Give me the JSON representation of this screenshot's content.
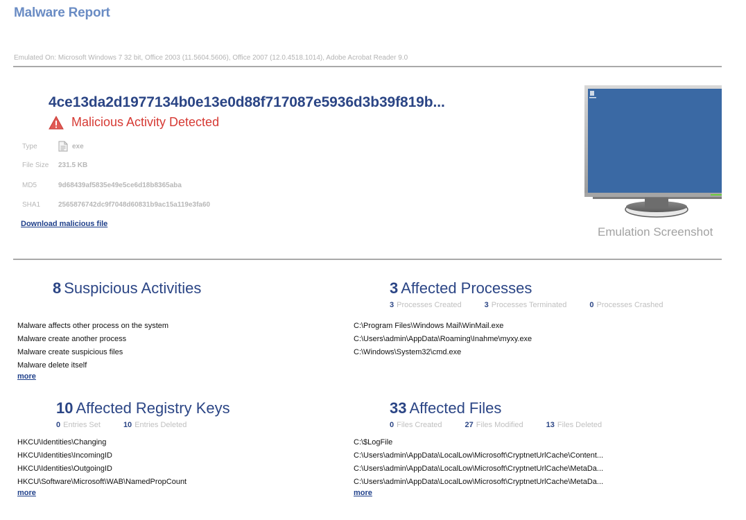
{
  "header": {
    "title": "Malware Report",
    "emulated_on": "Emulated On: Microsoft Windows 7 32 bit, Office 2003 (11.5604.5606), Office 2007 (12.0.4518.1014), Adobe Acrobat Reader 9.0"
  },
  "sample": {
    "hash_title": "4ce13da2d1977134b0e13e0d88f717087e5936d3b39f819b...",
    "verdict": "Malicious Activity Detected",
    "verdict_icon": "warning-triangle-icon",
    "fields": [
      {
        "label": "Type",
        "value": "exe",
        "icon": "document-icon"
      },
      {
        "label": "File Size",
        "value": "231.5 KB"
      },
      {
        "label": "MD5",
        "value": "9d68439af5835e49e5ce6d18b8365aba"
      },
      {
        "label": "SHA1",
        "value": "2565876742dc9f7048d60831b9ac15a119e3fa60"
      }
    ],
    "download_label": "Download malicious file"
  },
  "screenshot": {
    "caption": "Emulation Screenshot",
    "icon": "monitor-icon"
  },
  "colors": {
    "title": "#6a8cc4",
    "accent": "#2b4585",
    "danger": "#d63a34",
    "link": "#1e3f8a",
    "muted": "#b7b7b7"
  },
  "sections": {
    "activities": {
      "count": "8",
      "title": "Suspicious Activities",
      "items": [
        "Malware affects other process on the system",
        "Malware create another process",
        "Malware create suspicious files",
        "Malware delete itself"
      ],
      "more_label": "more"
    },
    "processes": {
      "count": "3",
      "title": "Affected Processes",
      "stats": [
        {
          "num": "3",
          "label": "Processes Created"
        },
        {
          "num": "3",
          "label": "Processes Terminated"
        },
        {
          "num": "0",
          "label": "Processes Crashed"
        }
      ],
      "items": [
        "C:\\Program Files\\Windows Mail\\WinMail.exe",
        "C:\\Users\\admin\\AppData\\Roaming\\Inahme\\myxy.exe",
        "C:\\Windows\\System32\\cmd.exe"
      ]
    },
    "registry": {
      "count": "10",
      "title": "Affected Registry Keys",
      "stats": [
        {
          "num": "0",
          "label": "Entries Set"
        },
        {
          "num": "10",
          "label": "Entries Deleted"
        }
      ],
      "items": [
        "HKCU\\Identities\\Changing",
        "HKCU\\Identities\\IncomingID",
        "HKCU\\Identities\\OutgoingID",
        "HKCU\\Software\\Microsoft\\WAB\\NamedPropCount"
      ],
      "more_label": "more"
    },
    "files": {
      "count": "33",
      "title": "Affected Files",
      "stats": [
        {
          "num": "0",
          "label": "Files Created"
        },
        {
          "num": "27",
          "label": "Files Modified"
        },
        {
          "num": "13",
          "label": "Files Deleted"
        }
      ],
      "items": [
        "C:\\$LogFile",
        "C:\\Users\\admin\\AppData\\LocalLow\\Microsoft\\CryptnetUrlCache\\Content...",
        "C:\\Users\\admin\\AppData\\LocalLow\\Microsoft\\CryptnetUrlCache\\MetaDa...",
        "C:\\Users\\admin\\AppData\\LocalLow\\Microsoft\\CryptnetUrlCache\\MetaDa..."
      ],
      "more_label": "more"
    }
  }
}
